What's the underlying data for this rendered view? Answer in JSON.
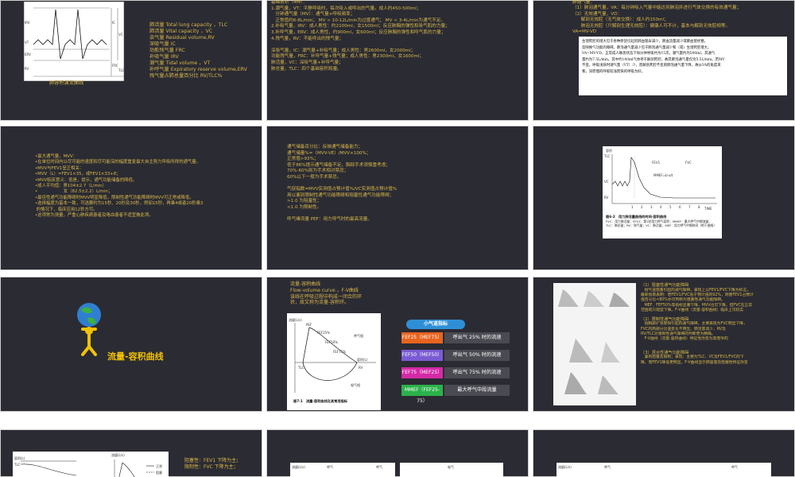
{
  "slides": {
    "s1": {
      "labels": [
        "肺活量 Total lung capacity ，TLC",
        "肺活量 Vital capacity ，VC",
        "余气量 Residual volume,RV",
        "深吸气量 IC",
        "功能残气量 FRC",
        "补吸气量 IRV",
        "潮气量 Tidal volume ，VT",
        "补呼气量 Expiratory reserve volume,ERV",
        "残气量占肺总量百分比 RV/TLC%"
      ],
      "caption": "肺容积演变曲线",
      "axis_labels": [
        "IRV",
        "VT",
        "ERV",
        "RV",
        "IC",
        "VC",
        "FRC",
        "TLC"
      ]
    },
    "s2": {
      "text": "基础容积（4种）：\n1.潮气量，VT：平静呼吸时，每次吸入或呼出的气量。成人约450-500ml；\n   分钟通气量（MV）：通气量×呼吸频率；\n   正常值约6-8L/min； MV > 10-12L/min为过度通气； MV < 3-4L/min为通气不足。\n2.补吸气量，IRV：成人男性：约2100ml，女1500ml；反应肺胸的弹性和吸气肌的力量；\n3.补呼气量，ERV：成人男性，约900ml，女600ml；反应肺胸的弹性和呼气肌的力量；\n4.残气量，RV：不能呼出的残气量；\n\n深吸气量，IC：潮气量+补吸气量；成人男性：男2600ml，女2000ml；\n功能残气量，FRC：补呼气量+残气量；成人男性：男2300ml，女1600ml；\n肺活量，VC：深吸气量+补呼气量；\n肺总量，TLC：四个基础容积和量。"
    },
    "s3": {
      "text": "肺通气量：\n（1）肺泡通气量，VA：每分钟吸入气量中能达到肺泡并进行气体交换的有效通气量；\n（2）无效通气量，VD：\n      解剖无效腔（无气体交换）：成人约150ml；\n      肺泡无效腔（只解剖生理无效腔）：健康人可不计，基本与解剖无效腔相等。\nVA=MV-VD",
      "panel_text": "生理死腔的增大见于各种原因引起的肺血管床减少，肺血流量减少或肺血管栓塞，\n反映换气功能的障碍。肺泡通气量减少见于肺泡通气量减少和（或）生理死腔增大。\nVA=MV-VD，正常成人静息状态下每分钟呼吸约为15次，潮气量约为500ml，其通气\n量约为7.5L/min。其中约140ml气体停于解剖死腔，故其肺泡通气量仅为5.5L/min。若MV\n不变，呼吸浅快时潮气量（VT）少，而解剖死腔不变则肺泡通气量下降，故从VA的角度来\n看，深而慢的呼吸较浅而快的呼吸为好。"
    },
    "s4": {
      "text": "•最大通气量，MVV：\n•在单位时间内以尽可能的速度和尽可能深的幅度重复最大自主努力呼吸所得的通气量。\n•MVV与FEV1呈正相关：\n•MVV（L）=FEV1×35，或FEV1×33+8；\n•MVV临床意义：低是，提示，通气功能储备的降低。\n•成人平均值：男104±2.7（L/min）\n•                   女（82.5±2.2）L/min；\n•最佳性通气功能障碍时MVV明显降低，限制性通气功能障碍时MVV可正常或降低。\n•选择幅度为基本一致，可选要约为15秒、20秒及30秒，例如15秒，再乘4或者20秒乘3\n 的情况下，临床应用12秒方可。\n•这项常为测量，严重心肺疾病患者及咯血患者不适宜做此项。"
    },
    "s5": {
      "text": "通气储备百分比：反映通气储备能力；\n通气储量%=（MVV-VE）/MVV×100%；\n正常值>93%；\n低于86%提示通气储备不足，胸部手术须慎重考虑；\n70%-60%则为手术相对禁忌；\n60%以下一般为手术禁忌。\n\n气促指数=MVV实测值占预计值%/VC实测值占预计值%\n用以鉴别限制性通气功能障碍和阻塞性通气功能障碍；\n>1.0 为阻塞性；\n<1.0 为限制性。\n\n呼气峰流量 PEF：用力呼气时的最高流量。"
    },
    "s6": {
      "fig_title": "图6-2　用力肺活量曲线的时间-容积曲线",
      "fig_caption": "FVC：用力肺活量；FEV1：第1秒用力呼气容积；MMEF：最大呼气中期流量；TLC：肺总量；RV：残气量；VC：肺活量；MEF：用力呼气中期时间（附干曲线）",
      "plot_labels": [
        "容积",
        "TLC",
        "FEV1",
        "FVC",
        "MMEF=b-a/t",
        "VC",
        "RV",
        "TIME",
        "1",
        "2",
        "3",
        "4",
        "5",
        "6",
        "7",
        "8"
      ]
    },
    "s7": {
      "title": "流量-容积曲线"
    },
    "s8": {
      "intro": "流量-容积曲线\nFlow-volume curve ，F-V曲线\n该线在呼吸过程中构成一闭合的环\n状，故又称为流量-容积环。",
      "fig_caption": "图7-1　流量-容积曲线及其常用指标",
      "fig_labels": [
        "流量(L/s)",
        "PEF",
        "FEF25%",
        "FEF50%",
        "FEF75%",
        "呼气相",
        "容积(L)",
        "TLC",
        "RV",
        "吸气相"
      ],
      "section_title": "小气道指标",
      "indicators": [
        {
          "code": "FEF25（MEF75）",
          "desc": "呼出气 25% 时的流速",
          "color": "#e8641e"
        },
        {
          "code": "FEF50（MEF50）",
          "desc": "呼出气 50% 时的流速",
          "color": "#7a5bd3"
        },
        {
          "code": "FEF75（MEF25）",
          "desc": "呼出气 75% 时的流速",
          "color": "#d42aa6"
        },
        {
          "code": "MMEF（FEF25-75）",
          "desc": "最大呼气中段流量",
          "color": "#2bb24a"
        }
      ]
    },
    "s9": {
      "p1_title": "（1）阻塞性通气功能障碍",
      "p1": "   指气道阻塞引起的通气障碍，表现上以FEV1/FVC下降为标志，\n最新指南表明：若FEV1/FVC低于预计值的92%，则使FEV1占预计\n值百分比<80%亦可判断为阻塞性通气功能障碍。\n   MEF、FEF50%等指标显著下降，MVV也可下降，但FVC在正常\n范围或只轻度下降。F-V曲线（流量-容积曲线）临床上可较实\n",
      "p2_title": "（2）限制性通气功能障碍",
      "p2": "   指胸部扩张受限引起的通气障碍。主要表现为FVC明显下降，\nFVC的两部分比值变化不明显，肺活量减少，RV及\nRV/TLC对限制性通气障碍的判断更为精确。\n   F-V曲线（流量-容积曲线）特征性改变为高而窄的\n",
      "p3_title": "（3）混合性通气功能障碍",
      "p3": "   兼有阻塞及限制；表现：主要为TLC、VC及FEV1/FVC的下\n降，而FEV1降低更明显。F-V曲线显示肺容量及阻塞性特征改变\n"
    },
    "s10": {
      "labels": [
        "容积(L)",
        "流量(L/s)",
        "正常",
        "阻塞",
        "限制",
        "TLC",
        "RV"
      ],
      "right_text": "阻塞性：FEV1 下降为主；\n限制性：FVC 下降为主；"
    },
    "s11": {
      "labels": [
        "流量(L/s)",
        "呼气",
        "呼气",
        "吸气"
      ]
    },
    "s12": {
      "labels": [
        "流量(L/s)",
        "呼气",
        "呼气"
      ]
    }
  }
}
